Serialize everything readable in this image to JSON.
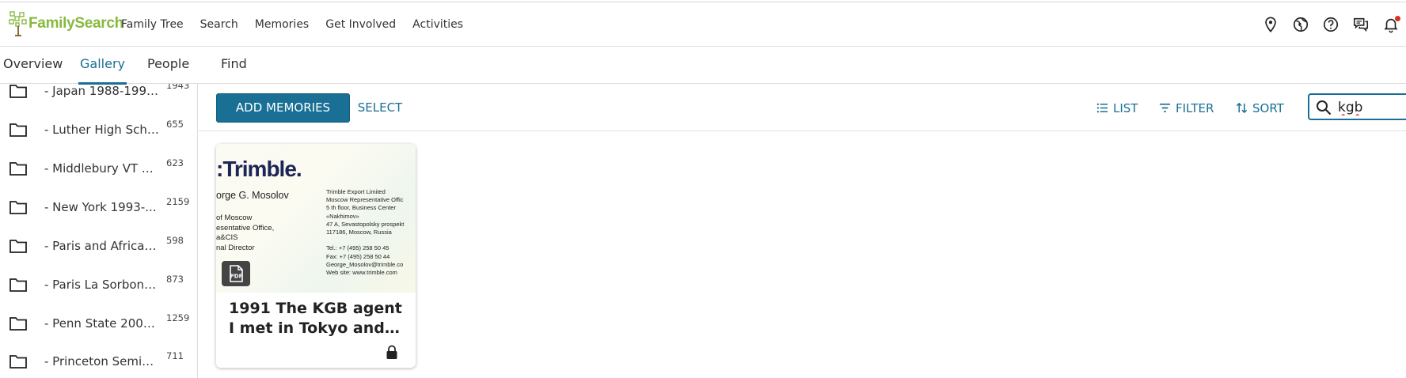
{
  "header": {
    "logo_text": "FamilySearch",
    "nav": [
      "Family Tree",
      "Search",
      "Memories",
      "Get Involved",
      "Activities"
    ],
    "icons": [
      "location-pin-icon",
      "globe-icon",
      "help-icon",
      "messages-icon",
      "bell-icon"
    ],
    "notification_dot_color": "#d93025"
  },
  "subnav": {
    "tabs": [
      "Overview",
      "Gallery",
      "People",
      "Find"
    ],
    "active": "Gallery"
  },
  "sidebar": {
    "folders": [
      {
        "name": "- Japan 1988-1991...",
        "count": "1943"
      },
      {
        "name": "- Luther High Scho...",
        "count": "655"
      },
      {
        "name": "- Middlebury VT an...",
        "count": "623"
      },
      {
        "name": "- New York 1993-...",
        "count": "2159"
      },
      {
        "name": "- Paris and Africa 1...",
        "count": "598"
      },
      {
        "name": "- Paris La Sorbonn...",
        "count": "873"
      },
      {
        "name": "- Penn State 2006...",
        "count": "1259"
      },
      {
        "name": "- Princeton Semin...",
        "count": "711"
      }
    ]
  },
  "toolbar": {
    "add_label": "ADD MEMORIES",
    "select_label": "SELECT",
    "list_label": "LIST",
    "filter_label": "FILTER",
    "sort_label": "SORT",
    "search_value": "kgb"
  },
  "card": {
    "title": "1991 The KGB agent I met in Tokyo and hu...",
    "badge": "PDF",
    "thumb": {
      "brand": ":Trimble.",
      "person": "orge G. Mosolov",
      "left_lines": [
        "of Moscow",
        "esentative Office,",
        "a&CIS",
        "nal Director"
      ],
      "right_lines": [
        "Trimble Export Limited",
        "Moscow Representative Offic",
        "5 th floor, Business Center",
        "«Nakhimov»",
        "47 A, Sevastopolsky prospekt",
        "117186, Moscow, Russia",
        "",
        "Tel.: +7 (495) 258 50 45",
        "Fax: +7 (495) 258 50 44",
        "George_Mosolov@trimble.co",
        "Web site: www.trimble.com"
      ]
    }
  },
  "colors": {
    "accent": "#1a6f94",
    "logo_green": "#87b940",
    "brand_navy": "#1d2557"
  }
}
